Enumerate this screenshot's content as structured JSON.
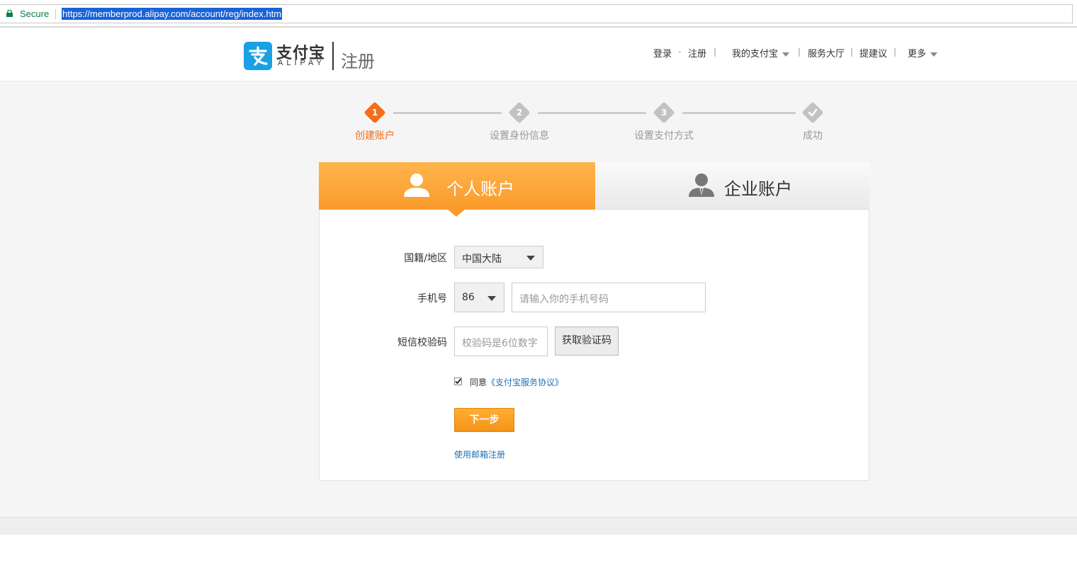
{
  "browser": {
    "secure_label": "Secure",
    "url": "https://memberprod.alipay.com/account/reg/index.htm"
  },
  "header": {
    "logo_cn": "支付宝",
    "logo_en": "ALIPAY",
    "page_title": "注册",
    "nav": {
      "login": "登录",
      "dash": "-",
      "register": "注册",
      "my_alipay": "我的支付宝",
      "service_hall": "服务大厅",
      "feedback": "提建议",
      "more": "更多",
      "sep": "|"
    }
  },
  "steps": {
    "current": 1,
    "items": [
      {
        "num": "1",
        "label": "创建账户"
      },
      {
        "num": "2",
        "label": "设置身份信息"
      },
      {
        "num": "3",
        "label": "设置支付方式"
      },
      {
        "num": "",
        "label": "成功"
      }
    ]
  },
  "tabs": {
    "personal": "个人账户",
    "business": "企业账户"
  },
  "form": {
    "nationality_label": "国籍/地区",
    "nationality_value": "中国大陆",
    "phone_label": "手机号",
    "phone_code": "86",
    "phone_placeholder": "请输入你的手机号码",
    "sms_label": "短信校验码",
    "sms_placeholder": "校验码是6位数字",
    "get_code": "获取验证码",
    "agree_prefix": "同意",
    "agree_link": "《支付宝服务协议》",
    "agree_checked": true,
    "next": "下一步",
    "email_register": "使用邮箱注册"
  },
  "colors": {
    "accent": "#fa9a2b",
    "active_step": "#f56d17",
    "link": "#1f6fb5",
    "logo_blue": "#1aa0e4"
  }
}
